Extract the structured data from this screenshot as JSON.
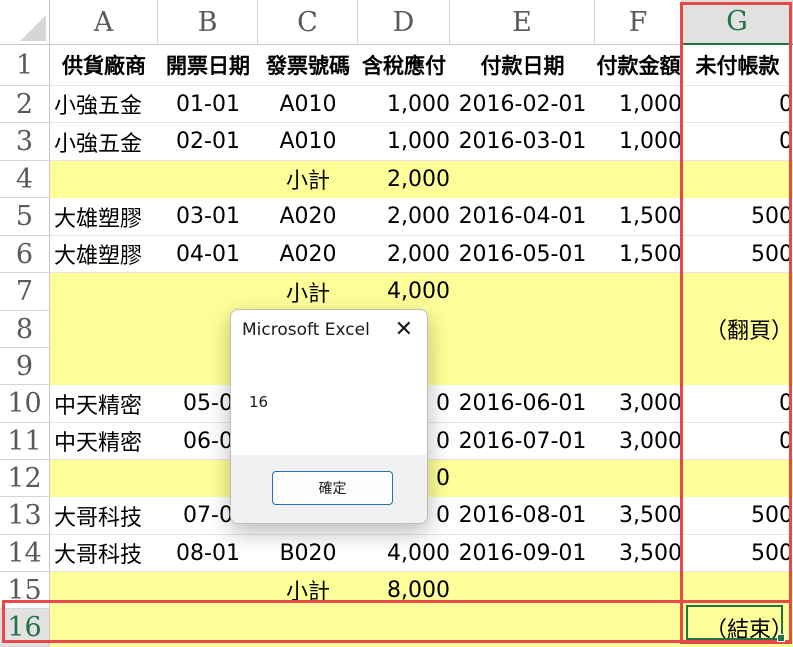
{
  "columns": [
    "A",
    "B",
    "C",
    "D",
    "E",
    "F",
    "G"
  ],
  "header_row": {
    "A": "供貨廠商",
    "B": "開票日期",
    "C": "發票號碼",
    "D": "含稅應付",
    "E": "付款日期",
    "F": "付款金額",
    "G": "未付帳款"
  },
  "rows": [
    {
      "num": "1"
    },
    {
      "num": "2",
      "A": "小強五金",
      "B": "01-01",
      "C": "A010",
      "D": "1,000",
      "E": "2016-02-01",
      "F": "1,000",
      "G": "0"
    },
    {
      "num": "3",
      "A": "小強五金",
      "B": "02-01",
      "C": "A010",
      "D": "1,000",
      "E": "2016-03-01",
      "F": "1,000",
      "G": "0"
    },
    {
      "num": "4",
      "C": "小計",
      "D": "2,000"
    },
    {
      "num": "5",
      "A": "大雄塑膠",
      "B": "03-01",
      "C": "A020",
      "D": "2,000",
      "E": "2016-04-01",
      "F": "1,500",
      "G": "500"
    },
    {
      "num": "6",
      "A": "大雄塑膠",
      "B": "04-01",
      "C": "A020",
      "D": "2,000",
      "E": "2016-05-01",
      "F": "1,500",
      "G": "500"
    },
    {
      "num": "7",
      "C": "小計",
      "D": "4,000"
    },
    {
      "num": "8",
      "G": "（翻頁）"
    },
    {
      "num": "9"
    },
    {
      "num": "10",
      "A": "中天精密",
      "B": "05-0",
      "C": "",
      "D": "0",
      "E": "2016-06-01",
      "F": "3,000",
      "G": "0"
    },
    {
      "num": "11",
      "A": "中天精密",
      "B": "06-0",
      "C": "",
      "D": "0",
      "E": "2016-07-01",
      "F": "3,000",
      "G": "0"
    },
    {
      "num": "12",
      "C": "",
      "D": "0"
    },
    {
      "num": "13",
      "A": "大哥科技",
      "B": "07-0",
      "C": "",
      "D": "0",
      "E": "2016-08-01",
      "F": "3,500",
      "G": "500"
    },
    {
      "num": "14",
      "A": "大哥科技",
      "B": "08-01",
      "C": "B020",
      "D": "4,000",
      "E": "2016-09-01",
      "F": "3,500",
      "G": "500"
    },
    {
      "num": "15",
      "C": "小計",
      "D": "8,000"
    },
    {
      "num": "16",
      "G": "（結束）"
    }
  ],
  "dialog": {
    "title": "Microsoft Excel",
    "close_glyph": "✕",
    "message": "16",
    "ok_label": "確定"
  },
  "colors": {
    "highlight_yellow": "#ffff99",
    "annotation_red": "#e84848",
    "excel_green": "#217346"
  }
}
